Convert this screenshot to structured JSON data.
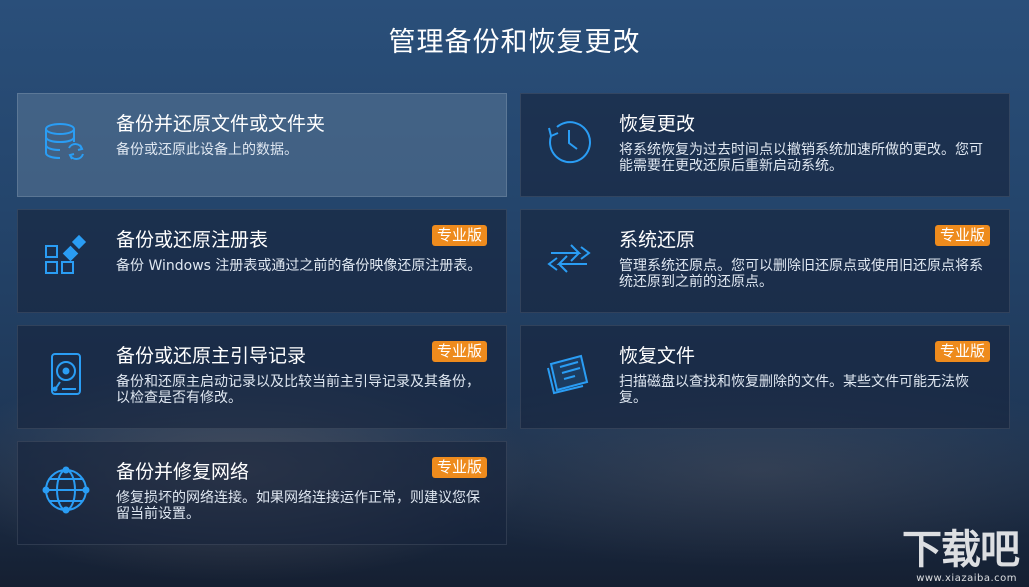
{
  "page": {
    "title": "管理备份和恢复更改"
  },
  "cards": [
    {
      "title": "备份并还原文件或文件夹",
      "desc": "备份或还原此设备上的数据。",
      "badge": "",
      "icon": "database-sync-icon"
    },
    {
      "title": "恢复更改",
      "desc": "将系统恢复为过去时间点以撤销系统加速所做的更改。您可能需要在更改还原后重新启动系统。",
      "badge": "",
      "icon": "clock-history-icon"
    },
    {
      "title": "备份或还原注册表",
      "desc": "备份 Windows 注册表或通过之前的备份映像还原注册表。",
      "badge": "专业版",
      "icon": "registry-blocks-icon"
    },
    {
      "title": "系统还原",
      "desc": "管理系统还原点。您可以删除旧还原点或使用旧还原点将系统还原到之前的还原点。",
      "badge": "专业版",
      "icon": "restore-arrows-icon"
    },
    {
      "title": "备份或还原主引导记录",
      "desc": "备份和还原主启动记录以及比较当前主引导记录及其备份，以检查是否有修改。",
      "badge": "专业版",
      "icon": "hard-drive-icon"
    },
    {
      "title": "恢复文件",
      "desc": "扫描磁盘以查找和恢复删除的文件。某些文件可能无法恢复。",
      "badge": "专业版",
      "icon": "file-recover-icon"
    },
    {
      "title": "备份并修复网络",
      "desc": "修复损坏的网络连接。如果网络连接运作正常，则建议您保留当前设置。",
      "badge": "专业版",
      "icon": "network-globe-icon"
    }
  ],
  "watermark": {
    "text": "下载吧",
    "url": "www.xiazaiba.com"
  },
  "colors": {
    "icon": "#2a9df4",
    "badge": "#ee8b1d"
  }
}
